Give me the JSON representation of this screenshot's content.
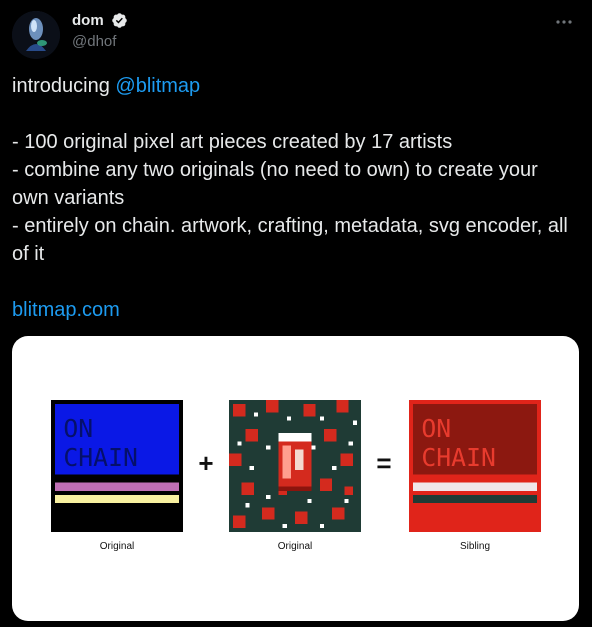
{
  "author": {
    "display_name": "dom",
    "handle": "@dhof",
    "verified": true
  },
  "tweet": {
    "intro_prefix": "introducing ",
    "mention": "@blitmap",
    "line1": "- 100 original pixel art pieces created by 17 artists",
    "line2": "- combine any two originals (no need to own) to create your own variants",
    "line3": "- entirely on chain. artwork, crafting, metadata, svg encoder, all of it",
    "link": "blitmap.com"
  },
  "media": {
    "operator_plus": "+",
    "operator_equals": "=",
    "captions": [
      "Original",
      "Original",
      "Sibling"
    ],
    "panel1_text": [
      "ON",
      "CHAIN"
    ],
    "panel3_text": [
      "ON",
      "CHAIN"
    ]
  },
  "icons": {
    "verified": "verified-badge-icon",
    "more": "more-horizontal-icon"
  },
  "colors": {
    "background": "#000000",
    "text": "#e7e9ea",
    "secondary": "#71767b",
    "link": "#1d9bf0"
  }
}
